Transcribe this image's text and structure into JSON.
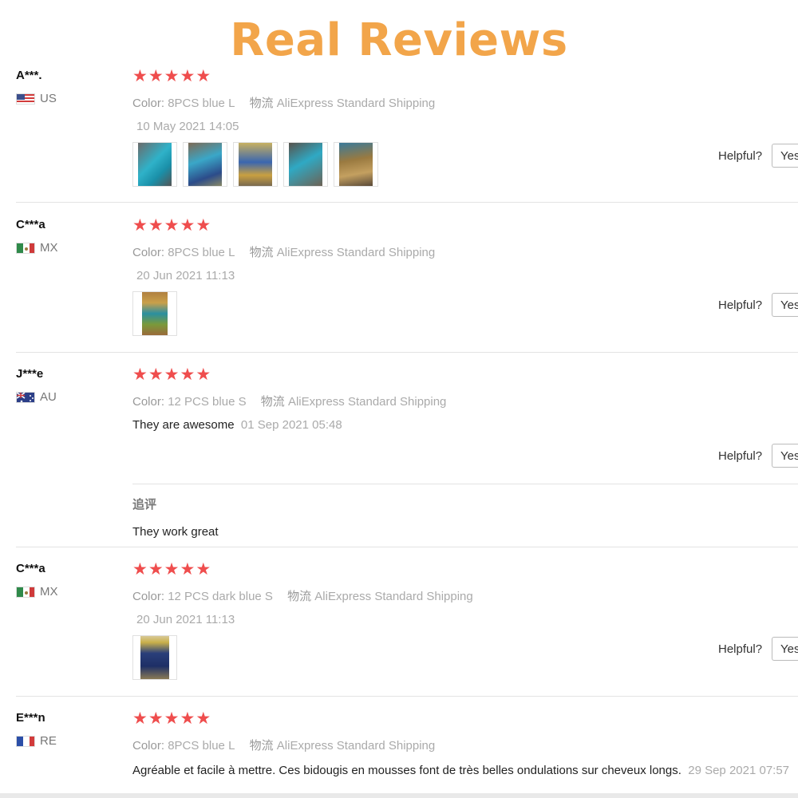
{
  "headline": {
    "text": "Real Reviews",
    "color": "#f2a54a"
  },
  "star_color": "#ef4d4d",
  "helpful_label": "Helpful?",
  "yes_label": "Yes",
  "reviews": [
    {
      "user": "A***.",
      "country": "US",
      "stars": 5,
      "color_label": "Color:",
      "color_value": "8PCS blue L",
      "shipping_label": "物流",
      "shipping_value": "AliExpress Standard Shipping",
      "text": "",
      "date": "10 May 2021 14:05",
      "photos": 5
    },
    {
      "user": "C***a",
      "country": "MX",
      "stars": 5,
      "color_label": "Color:",
      "color_value": "8PCS blue L",
      "shipping_label": "物流",
      "shipping_value": "AliExpress Standard Shipping",
      "text": "",
      "date": "20 Jun 2021 11:13",
      "photos": 1
    },
    {
      "user": "J***e",
      "country": "AU",
      "stars": 5,
      "color_label": "Color:",
      "color_value": "12 PCS blue S",
      "shipping_label": "物流",
      "shipping_value": "AliExpress Standard Shipping",
      "text": "They are awesome",
      "date": "01 Sep 2021 05:48",
      "photos": 0,
      "followup_title": "追评",
      "followup_text": "They work great"
    },
    {
      "user": "C***a",
      "country": "MX",
      "stars": 5,
      "color_label": "Color:",
      "color_value": "12 PCS dark blue S",
      "shipping_label": "物流",
      "shipping_value": "AliExpress Standard Shipping",
      "text": "",
      "date": "20 Jun 2021 11:13",
      "photos": 1
    },
    {
      "user": "E***n",
      "country": "RE",
      "stars": 5,
      "color_label": "Color:",
      "color_value": "8PCS blue L",
      "shipping_label": "物流",
      "shipping_value": "AliExpress Standard Shipping",
      "text": "Agréable et facile à mettre. Ces bidougis en mousses font de très belles ondulations sur cheveux longs.",
      "date": "29 Sep 2021 07:57",
      "photos": 0
    }
  ]
}
